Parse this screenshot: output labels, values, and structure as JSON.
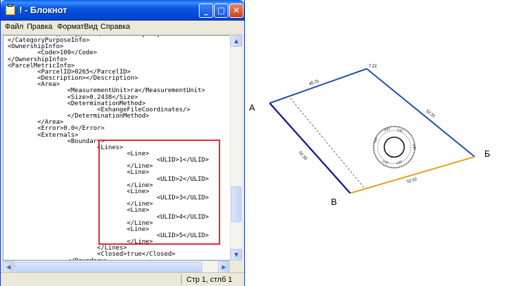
{
  "window": {
    "title": "! - Блокнот",
    "min_glyph": "_",
    "max_glyph": "□",
    "close_glyph": "✕"
  },
  "menu": {
    "items": [
      "Файл",
      "Правка",
      "Формат",
      "Вид",
      "Справка"
    ]
  },
  "editor": {
    "lines": [
      "\t\t<Use>для будівництва та обслуговування житлового",
      "</CategoryPurposeInfo>",
      "<OwnershipInfo>",
      "\t\t<Code>100</Code>",
      "</OwnershipInfo>",
      "<ParcelMetricInfo>",
      "\t\t<ParcelID>0265</ParcelID>",
      "\t\t<Description></Description>",
      "\t\t<Area>",
      "\t\t\t\t<MeasurementUnit>га</MeasurementUnit>",
      "\t\t\t\t<Size>0.2438</Size>",
      "\t\t\t\t<DeterminationMethod>",
      "\t\t\t\t\t\t<ExhangeFileCoordinates/>",
      "\t\t\t\t</DeterminationMethod>",
      "\t\t</Area>",
      "\t\t<Error>0.0</Error>",
      "\t\t<Externals>",
      "\t\t\t\t<Boundary>",
      "\t\t\t\t\t\t<Lines>",
      "\t\t\t\t\t\t\t\t<Line>",
      "\t\t\t\t\t\t\t\t\t\t<ULID>1</ULID>",
      "\t\t\t\t\t\t\t\t</Line>",
      "\t\t\t\t\t\t\t\t<Line>",
      "\t\t\t\t\t\t\t\t\t\t<ULID>2</ULID>",
      "\t\t\t\t\t\t\t\t</Line>",
      "\t\t\t\t\t\t\t\t<Line>",
      "\t\t\t\t\t\t\t\t\t\t<ULID>3</ULID>",
      "\t\t\t\t\t\t\t\t</Line>",
      "\t\t\t\t\t\t\t\t<Line>",
      "\t\t\t\t\t\t\t\t\t\t<ULID>4</ULID>",
      "\t\t\t\t\t\t\t\t</Line>",
      "\t\t\t\t\t\t\t\t<Line>",
      "\t\t\t\t\t\t\t\t\t\t<ULID>5</ULID>",
      "\t\t\t\t\t\t\t\t</Line>",
      "\t\t\t\t\t\t</Lines>",
      "\t\t\t\t\t\t<Closed>true</Closed>",
      "\t\t\t\t</Boundary>"
    ]
  },
  "status": {
    "position": "Стр 1, стлб 1"
  },
  "drawing": {
    "corners": {
      "a": "А",
      "b": "Б",
      "v": "В"
    },
    "segments": {
      "top_left": "45.31",
      "top_right": "7.22",
      "right": "52.31",
      "left": "52.33",
      "bottom": "52.52"
    },
    "circle_labels": [
      "0.87",
      "0.87",
      "0.87",
      "0.87",
      "0.87",
      "0.87"
    ],
    "colors": {
      "blue_boundary": "#1f4f9f",
      "orange_boundary": "#e0a020",
      "navy_boundary": "#1a1a8c"
    }
  }
}
